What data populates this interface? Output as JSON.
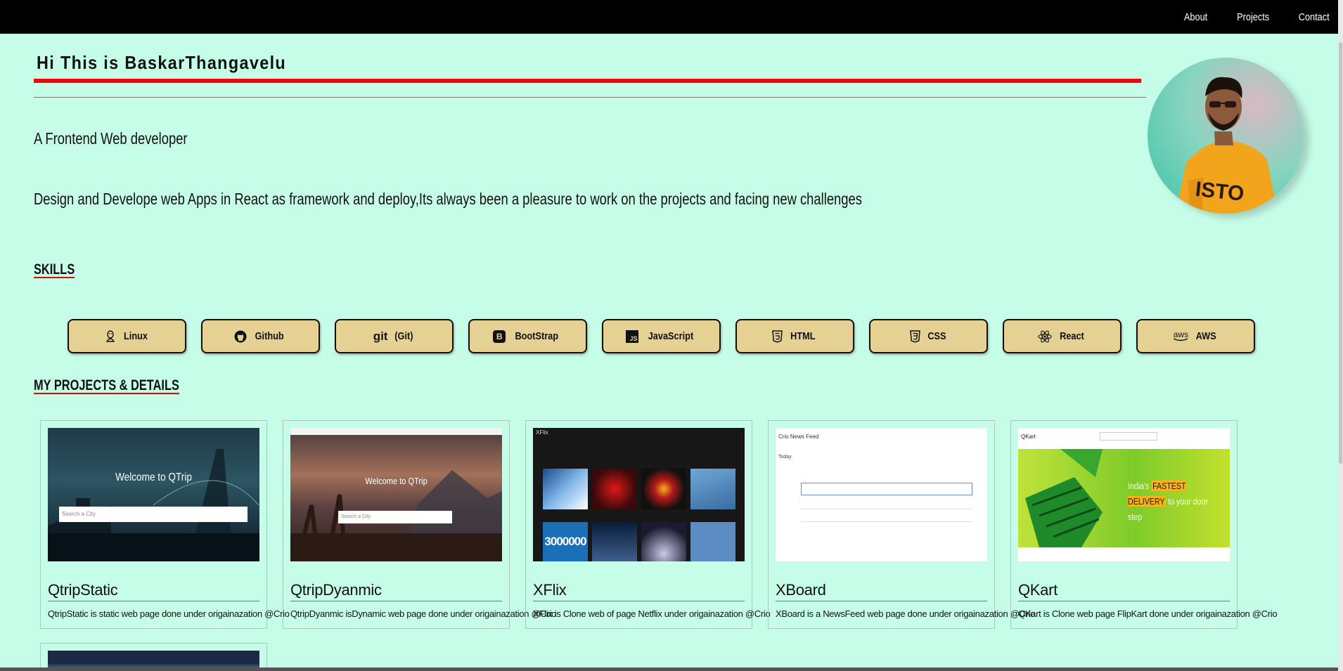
{
  "nav": {
    "items": [
      "About",
      "Projects",
      "Contact"
    ]
  },
  "hero": {
    "title": "Hi This is BaskarThangavelu",
    "tagline": "A Frontend Web developer",
    "description": "Design and Develope web Apps in React as framework and deploy,Its always been a pleasure to work on the projects and facing new challenges"
  },
  "skills_heading": "SKILLS",
  "skills": [
    {
      "label": "Linux",
      "icon": "linux-icon"
    },
    {
      "label": "Github",
      "icon": "github-icon"
    },
    {
      "label": "(Git)",
      "icon": "git-icon",
      "icon_text": "git"
    },
    {
      "label": "BootStrap",
      "icon": "bootstrap-icon",
      "icon_text": "B"
    },
    {
      "label": "JavaScript",
      "icon": "javascript-icon",
      "icon_text": "JS"
    },
    {
      "label": "HTML",
      "icon": "html5-icon",
      "icon_text": "5"
    },
    {
      "label": "CSS",
      "icon": "css3-icon",
      "icon_text": "3"
    },
    {
      "label": "React",
      "icon": "react-icon"
    },
    {
      "label": "AWS",
      "icon": "aws-icon",
      "icon_text": "aws"
    }
  ],
  "projects_heading": "MY PROJECTS & DETAILS",
  "projects": [
    {
      "title": "QtripStatic",
      "description": "QtripStatic is static web page done under origainazation @Crio",
      "screenshot": {
        "heading": "Welcome to QTrip",
        "input": "Search a City"
      }
    },
    {
      "title": "QtripDyanmic",
      "description": "QtripDyanmic isDynamic web page done under origainazation @Crio",
      "screenshot": {
        "heading": "Welcome to QTrip",
        "input": "Search a City"
      }
    },
    {
      "title": "XFlix",
      "description": "XFlix is Clone web of page Netflix under origainazation @Crio",
      "screenshot": {
        "brand": "XFlix",
        "tile_text": "3000000"
      }
    },
    {
      "title": "XBoard",
      "description": "XBoard is a NewsFeed web page done under origainazation @Crio",
      "screenshot": {
        "heading": "Crio News Feed",
        "subheading": "Today"
      }
    },
    {
      "title": "QKart",
      "description": "QKart is Clone web page FlipKart done under origainazation @Crio",
      "screenshot": {
        "brand": "QKart",
        "headline_pre": "India's",
        "headline_highlight": "FASTEST DELIVERY",
        "headline_post": "to your door step"
      }
    }
  ],
  "colors": {
    "background": "#c6fde9",
    "navbar": "#000000",
    "accent_red": "#ee0a0a",
    "skill_button": "#e4d193"
  }
}
